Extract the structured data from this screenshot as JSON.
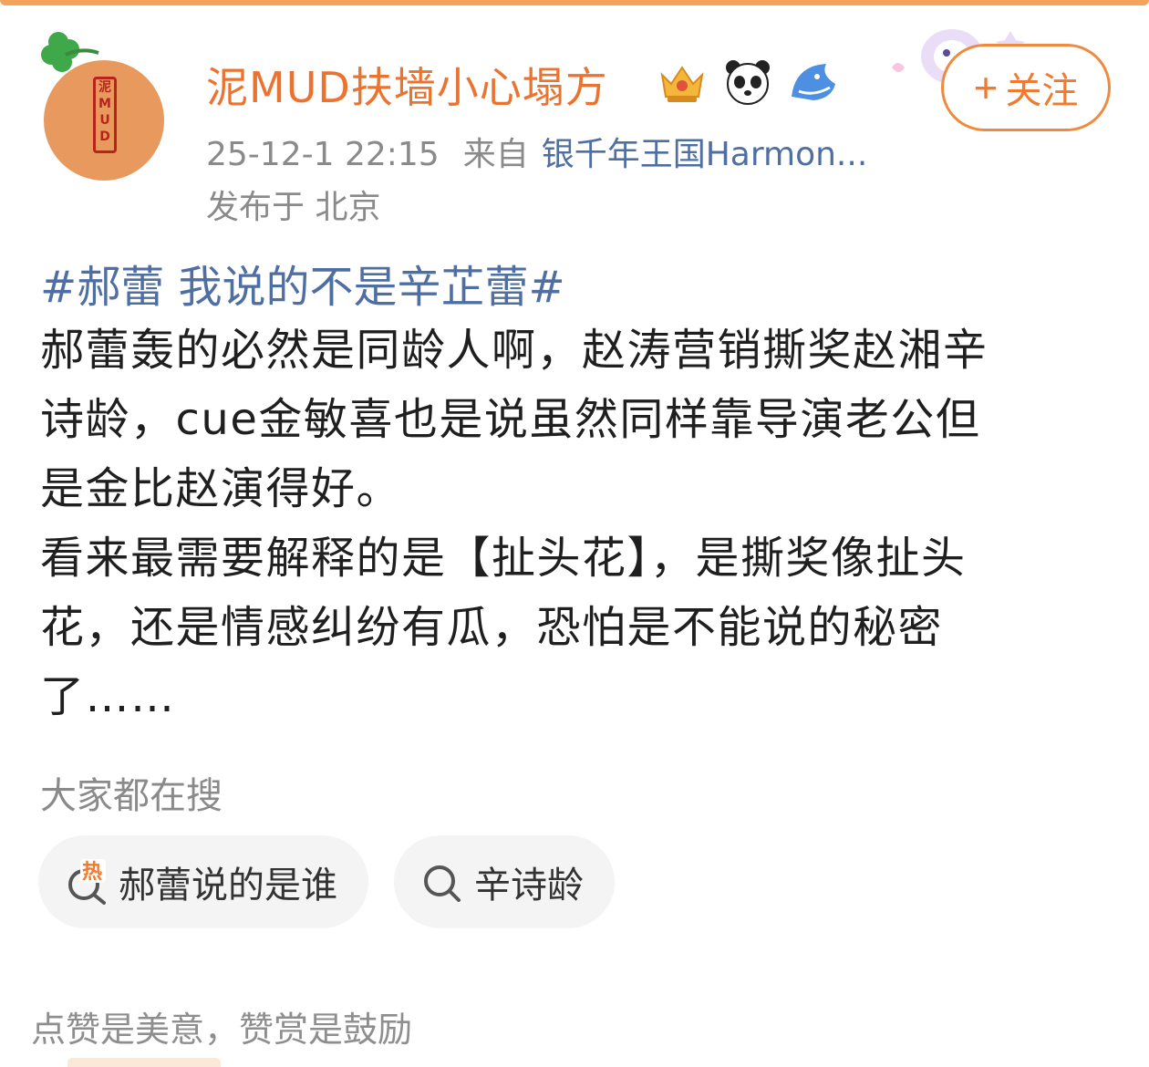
{
  "header": {
    "username": "泥MUD扶墙小心塌方",
    "avatar_seal": [
      "泥",
      "M",
      "U",
      "D"
    ],
    "badges": [
      "crown-badge-icon",
      "panda-icon",
      "shark-icon"
    ],
    "timestamp": "25-12-1 22:15",
    "source_prefix": "来自",
    "source": "银千年王国Harmon...",
    "location": "发布于 北京",
    "follow_label": "关注",
    "follow_plus": "+"
  },
  "post": {
    "hashtag": "#郝蕾 我说的不是辛芷蕾#",
    "lines": [
      "郝蕾轰的必然是同龄人啊，赵涛营销撕奖赵湘辛",
      "诗龄，cue金敏喜也是说虽然同样靠导演老公但",
      "是金比赵演得好。",
      "看来最需要解释的是【扯头花】，是撕奖像扯头",
      "花，还是情感纠纷有瓜，恐怕是不能说的秘密",
      "了……"
    ]
  },
  "search": {
    "title": "大家都在搜",
    "chips": [
      {
        "label": "郝蕾说的是谁",
        "icon": "hot-search-icon",
        "hot_mark": "热"
      },
      {
        "label": "辛诗龄",
        "icon": "search-icon"
      }
    ]
  },
  "footer": {
    "note": "点赞是美意，赞赏是鼓励"
  },
  "colors": {
    "username": "#eb7330",
    "link": "#4f6fa3",
    "follow": "#f07a30",
    "meta": "#8a8a8a"
  }
}
